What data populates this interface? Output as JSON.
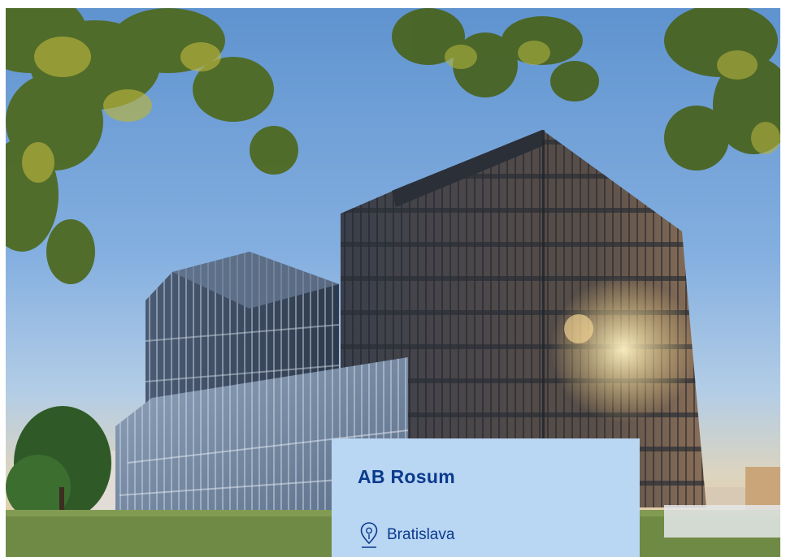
{
  "card": {
    "title": "AB Rosum",
    "location": "Bratislava"
  },
  "icons": {
    "location": "map-pin-icon"
  },
  "colors": {
    "card_background": "#b9d6f3",
    "card_text": "#0b3a8d"
  }
}
